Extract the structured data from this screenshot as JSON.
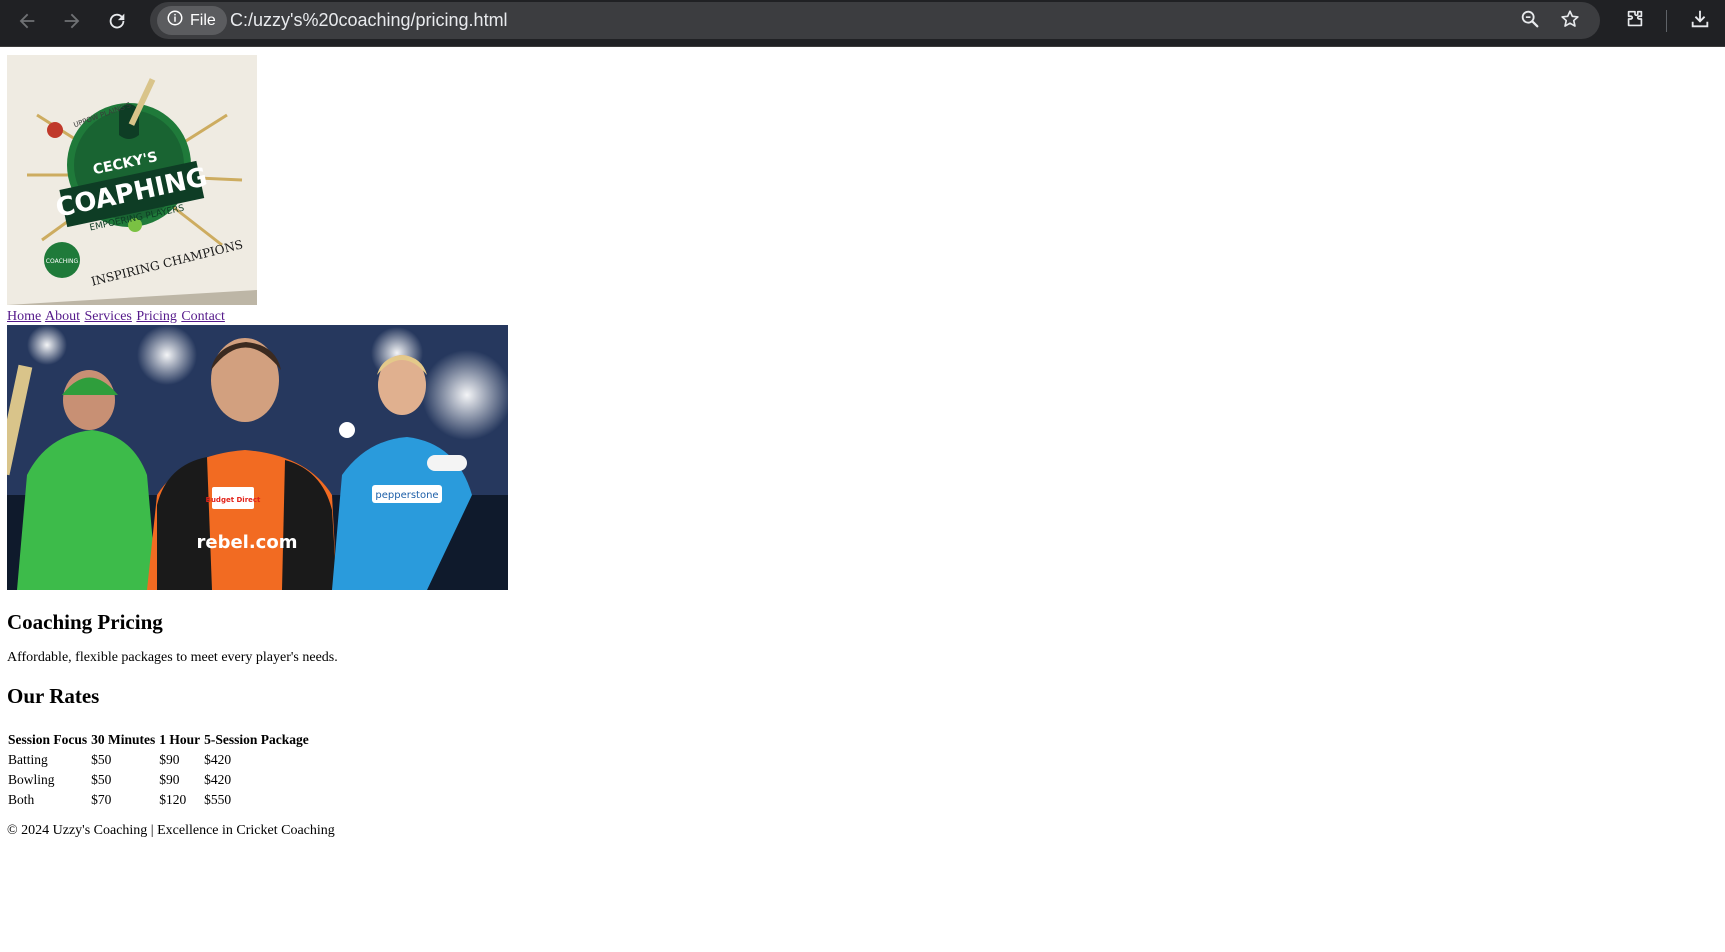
{
  "browser": {
    "site_chip_label": "File",
    "url": "C:/uzzy's%20coaching/pricing.html",
    "icons": [
      "back-arrow-icon",
      "forward-arrow-icon",
      "reload-icon",
      "info-icon",
      "zoom-icon",
      "star-icon",
      "extensions-icon",
      "download-icon"
    ]
  },
  "logo": {
    "text_top": "UPPOW PLAING'S",
    "text_name": "CECKY'S",
    "text_main": "COAPHING",
    "text_tagline": "EMPOERING PLAYERS",
    "text_bottom": "INSPIRING CHAMPIONS",
    "text_small": "COACHING",
    "colors": {
      "green": "#1f7a3a",
      "dark_green": "#0e3d25",
      "gold": "#c8a24a"
    }
  },
  "nav": {
    "items": [
      {
        "label": "Home"
      },
      {
        "label": "About"
      },
      {
        "label": "Services"
      },
      {
        "label": "Pricing"
      },
      {
        "label": "Contact"
      }
    ]
  },
  "hero": {
    "sponsor_1": "Budget Direct",
    "sponsor_2": "pepperstone",
    "shirt_text": "rebel.com",
    "colors": {
      "green_kit": "#3dbb4a",
      "orange_kit": "#f26b22",
      "blue_kit": "#2a9bdc"
    }
  },
  "main": {
    "title": "Coaching Pricing",
    "subtitle": "Affordable, flexible packages to meet every player's needs.",
    "rates_title": "Our Rates",
    "table": {
      "headers": [
        "Session Focus",
        "30 Minutes",
        "1 Hour",
        "5-Session Package"
      ],
      "rows": [
        [
          "Batting",
          "$50",
          "$90",
          "$420"
        ],
        [
          "Bowling",
          "$50",
          "$90",
          "$420"
        ],
        [
          "Both",
          "$70",
          "$120",
          "$550"
        ]
      ]
    }
  },
  "footer": {
    "text": "© 2024 Uzzy's Coaching | Excellence in Cricket Coaching"
  }
}
